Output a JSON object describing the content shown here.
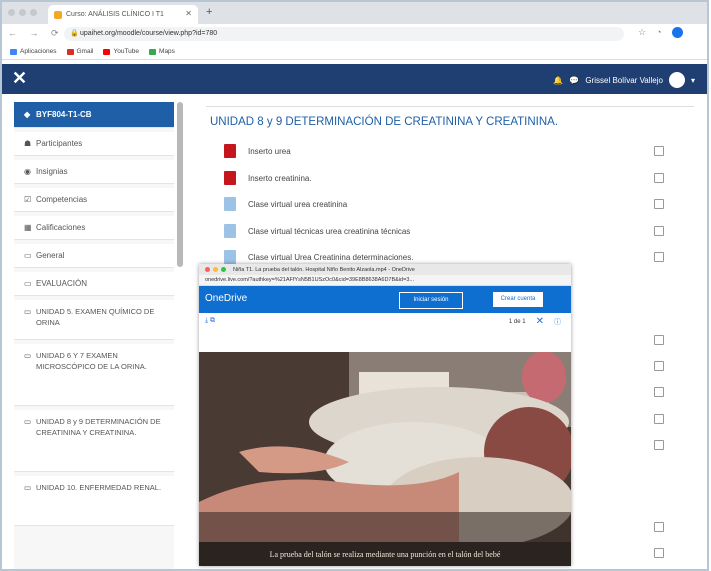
{
  "browser": {
    "tab_title": "Curso: ANÁLISIS CLÍNICO I T1",
    "url": "upaihet.org/moodle/course/view.php?id=780",
    "bookmarks": [
      "Aplicaciones",
      "Gmail",
      "YouTube",
      "Maps"
    ]
  },
  "navbar": {
    "user_name": "Grissel Bolívar Vallejo"
  },
  "sidebar": {
    "items": [
      {
        "label": "BYF804-T1-CB",
        "icon": "graduation-cap-icon"
      },
      {
        "label": "Participantes",
        "icon": "users-icon"
      },
      {
        "label": "Insignias",
        "icon": "badge-icon"
      },
      {
        "label": "Competencias",
        "icon": "check-square-icon"
      },
      {
        "label": "Calificaciones",
        "icon": "table-icon"
      },
      {
        "label": "General",
        "icon": "folder-icon"
      },
      {
        "label": "EVALUACIÓN",
        "icon": "folder-icon"
      },
      {
        "label": "UNIDAD 5. EXAMEN QUÍMICO DE ORINA",
        "icon": "folder-icon"
      },
      {
        "label": "UNIDAD 6 Y 7 EXAMEN MICROSCÓPICO DE LA ORINA.",
        "icon": "folder-icon"
      },
      {
        "label": "UNIDAD 8 y 9 DETERMINACIÓN DE CREATININA Y CREATININA.",
        "icon": "folder-icon"
      },
      {
        "label": "UNIDAD 10. ENFERMEDAD RENAL.",
        "icon": "folder-icon"
      }
    ]
  },
  "main": {
    "section_title": "UNIDAD 8 y 9 DETERMINACIÓN DE CREATININA Y CREATININA.",
    "activities": [
      {
        "label": "Inserto urea",
        "icon": "pdf-icon"
      },
      {
        "label": "Inserto creatinina.",
        "icon": "pdf-icon"
      },
      {
        "label": "Clase virtual urea creatinina",
        "icon": "document-icon"
      },
      {
        "label": "Clase virtual técnicas urea creatinina técnicas",
        "icon": "document-icon"
      },
      {
        "label": "Clase virtual Urea Creatinina determinaciones.",
        "icon": "document-icon"
      }
    ]
  },
  "popup": {
    "title": "Niña T1. La prueba del talón. Hospital Niño Benito Alzaola.mp4 - OneDrive",
    "url": "onedrive.live.com/?authkey=%21AFfYsN5B1USzOc0&cid=39E8B8638A6D7B&id=3...",
    "brand": "OneDrive",
    "signin_label": "Iniciar sesión",
    "create_label": "Crear cuenta",
    "page_counter": "1 de 1",
    "caption": "La prueba del talón se realiza mediante una punción en el talón del bebé"
  }
}
